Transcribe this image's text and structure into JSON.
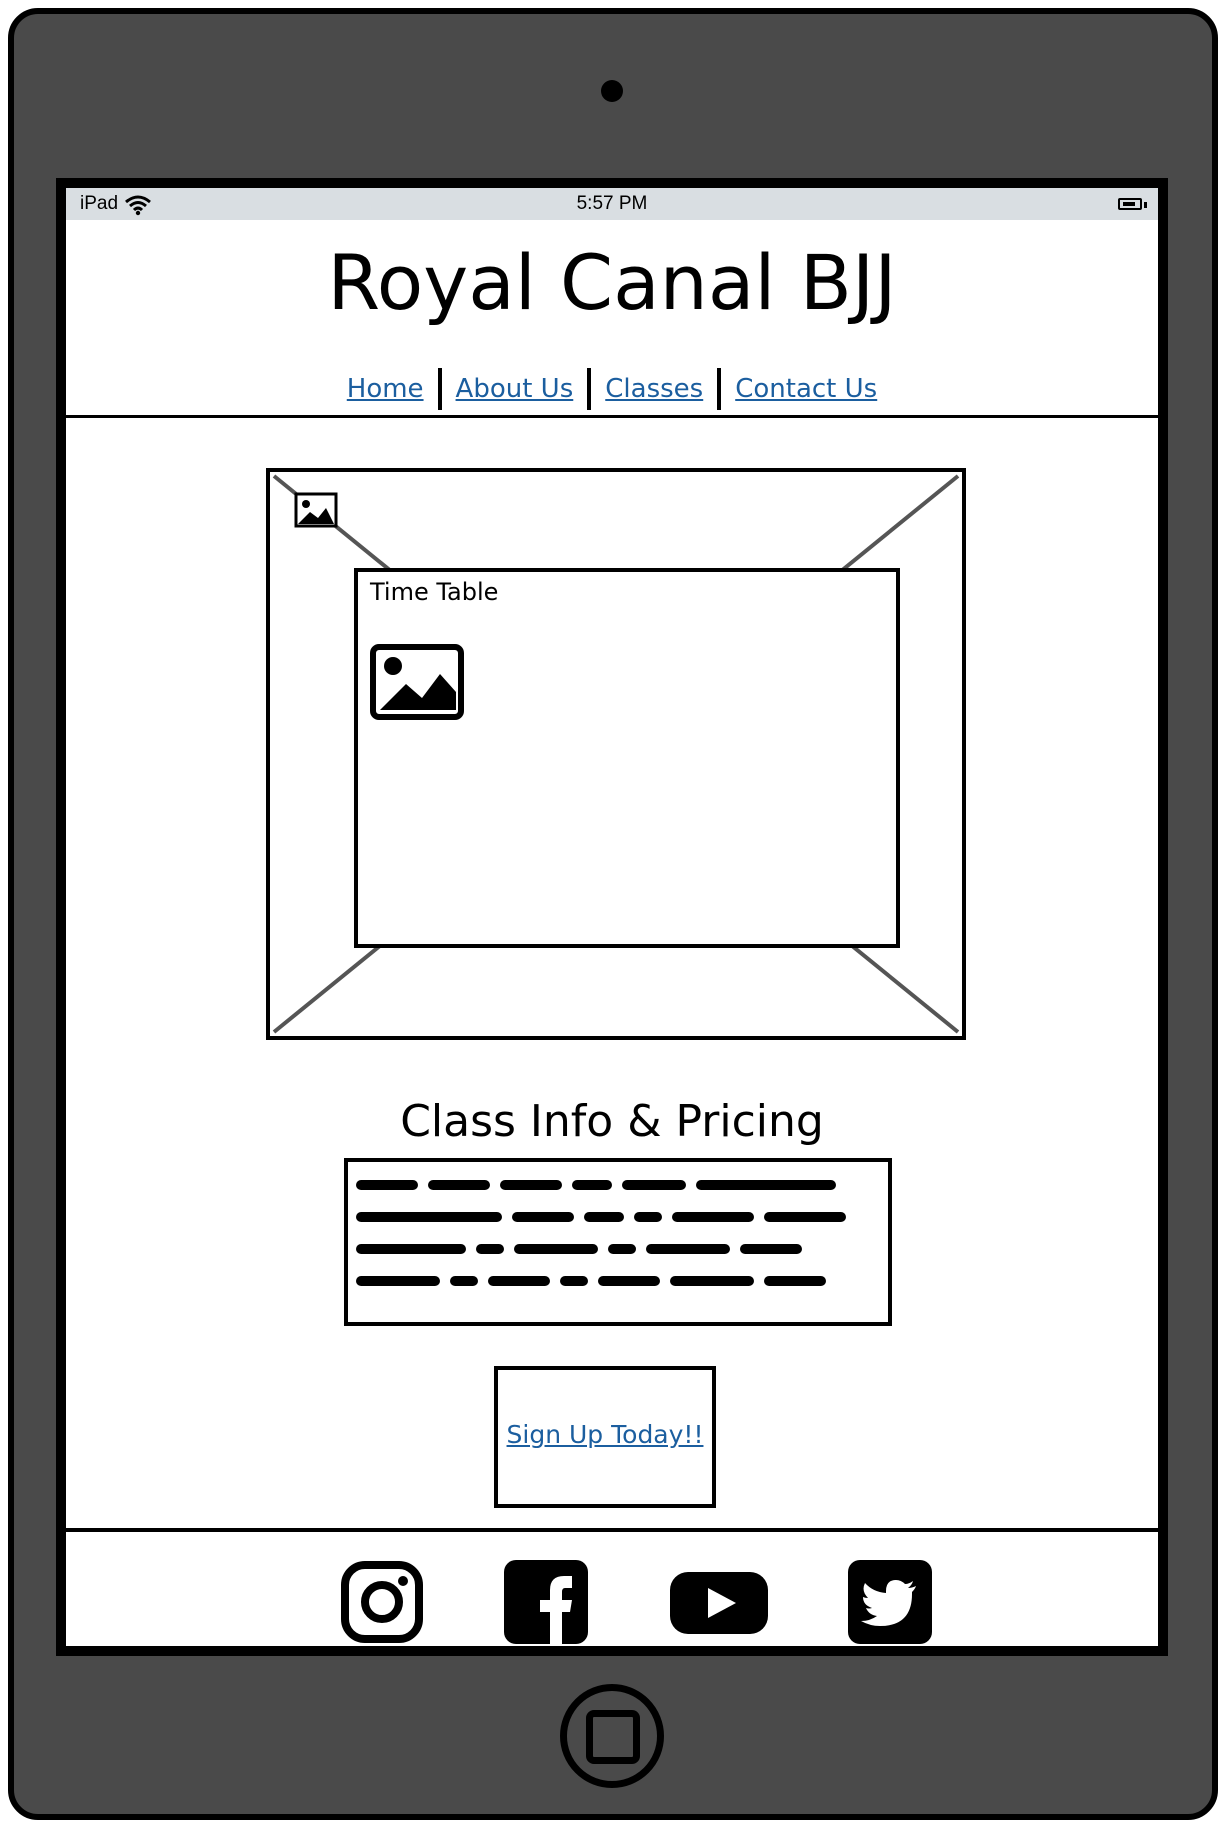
{
  "status_bar": {
    "device": "iPad",
    "time": "5:57 PM"
  },
  "header": {
    "title": "Royal Canal BJJ",
    "nav": [
      {
        "label": "Home"
      },
      {
        "label": "About Us"
      },
      {
        "label": "Classes"
      },
      {
        "label": "Contact Us"
      }
    ]
  },
  "hero": {
    "image_icon": "image-placeholder-icon",
    "timetable": {
      "title": "Time Table",
      "image_icon": "image-icon"
    }
  },
  "class_info": {
    "title": "Class Info & Pricing",
    "text_placeholder": "scribbled-text"
  },
  "cta": {
    "label": "Sign Up Today!!"
  },
  "footer": {
    "social": [
      {
        "name": "instagram-icon"
      },
      {
        "name": "facebook-icon"
      },
      {
        "name": "youtube-icon"
      },
      {
        "name": "twitter-icon"
      }
    ]
  },
  "colors": {
    "link": "#1b5e9f",
    "device_frame": "#4a4a4a",
    "status_bar": "#d9dee2"
  }
}
